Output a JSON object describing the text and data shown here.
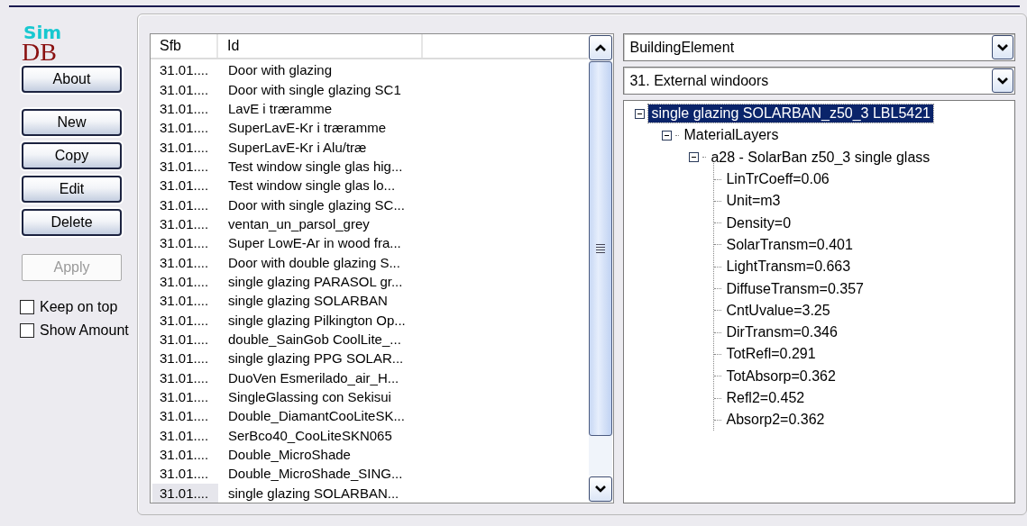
{
  "logo": {
    "top": "Sim",
    "bottom": "DB"
  },
  "buttons": [
    {
      "label": "About",
      "disabled": false
    },
    {
      "label": "New",
      "disabled": false
    },
    {
      "label": "Copy",
      "disabled": false
    },
    {
      "label": "Edit",
      "disabled": false
    },
    {
      "label": "Delete",
      "disabled": false
    },
    {
      "label": "Apply",
      "disabled": true
    }
  ],
  "options": [
    {
      "label": "Keep on top",
      "checked": false
    },
    {
      "label": "Show Amount",
      "checked": false
    }
  ],
  "table": {
    "columns": [
      "Sfb",
      "Id"
    ],
    "rows": [
      {
        "sfb": "31.01....",
        "id": "Door with glazing",
        "selected": false
      },
      {
        "sfb": "31.01....",
        "id": "Door with single glazing SC1",
        "selected": false
      },
      {
        "sfb": "31.01....",
        "id": "LavE i træramme",
        "selected": false
      },
      {
        "sfb": "31.01....",
        "id": "SuperLavE-Kr i træramme",
        "selected": false
      },
      {
        "sfb": "31.01....",
        "id": "SuperLavE-Kr i Alu/træ",
        "selected": false
      },
      {
        "sfb": "31.01....",
        "id": "Test window single glas hig...",
        "selected": false
      },
      {
        "sfb": "31.01....",
        "id": "Test window single glas lo...",
        "selected": false
      },
      {
        "sfb": "31.01....",
        "id": "Door with single glazing SC...",
        "selected": false
      },
      {
        "sfb": "31.01....",
        "id": "ventan_un_parsol_grey",
        "selected": false
      },
      {
        "sfb": "31.01....",
        "id": "Super LowE-Ar in wood fra...",
        "selected": false
      },
      {
        "sfb": "31.01....",
        "id": "Door with double glazing S...",
        "selected": false
      },
      {
        "sfb": "31.01....",
        "id": "single glazing PARASOL gr...",
        "selected": false
      },
      {
        "sfb": "31.01....",
        "id": "single glazing SOLARBAN",
        "selected": false
      },
      {
        "sfb": "31.01....",
        "id": "single glazing Pilkington Op...",
        "selected": false
      },
      {
        "sfb": "31.01....",
        "id": "double_SainGob CoolLite_...",
        "selected": false
      },
      {
        "sfb": "31.01....",
        "id": "single glazing PPG SOLAR...",
        "selected": false
      },
      {
        "sfb": "31.01....",
        "id": "DuoVen Esmerilado_air_H...",
        "selected": false
      },
      {
        "sfb": "31.01....",
        "id": "SingleGlassing con Sekisui",
        "selected": false
      },
      {
        "sfb": "31.01....",
        "id": "Double_DiamantCooLiteSK...",
        "selected": false
      },
      {
        "sfb": "31.01....",
        "id": "SerBco40_CooLiteSKN065",
        "selected": false
      },
      {
        "sfb": "31.01....",
        "id": "Double_MicroShade",
        "selected": false
      },
      {
        "sfb": "31.01....",
        "id": "Double_MicroShade_SING...",
        "selected": false
      },
      {
        "sfb": "31.01....",
        "id": "single glazing SOLARBAN...",
        "selected": true
      }
    ]
  },
  "dropdowns": [
    {
      "value": "BuildingElement"
    },
    {
      "value": "31. External windoors"
    }
  ],
  "tree": [
    {
      "label": "single glazing SOLARBAN_z50_3 LBL5421",
      "selected": true,
      "expanded": true,
      "children": [
        {
          "label": "MaterialLayers",
          "selected": false,
          "expanded": true,
          "children": [
            {
              "label": "a28 - SolarBan z50_3 single glass",
              "selected": false,
              "expanded": true,
              "children": [
                {
                  "label": "LinTrCoeff=0.06",
                  "selected": false
                },
                {
                  "label": "Unit=m3",
                  "selected": false
                },
                {
                  "label": "Density=0",
                  "selected": false
                },
                {
                  "label": "SolarTransm=0.401",
                  "selected": false
                },
                {
                  "label": "LightTransm=0.663",
                  "selected": false
                },
                {
                  "label": "DiffuseTransm=0.357",
                  "selected": false
                },
                {
                  "label": "CntUvalue=3.25",
                  "selected": false
                },
                {
                  "label": "DirTransm=0.346",
                  "selected": false
                },
                {
                  "label": "TotRefl=0.291",
                  "selected": false
                },
                {
                  "label": "TotAbsorp=0.362",
                  "selected": false
                },
                {
                  "label": "Refl2=0.452",
                  "selected": false
                },
                {
                  "label": "Absorp2=0.362",
                  "selected": false
                }
              ]
            }
          ]
        }
      ]
    }
  ]
}
